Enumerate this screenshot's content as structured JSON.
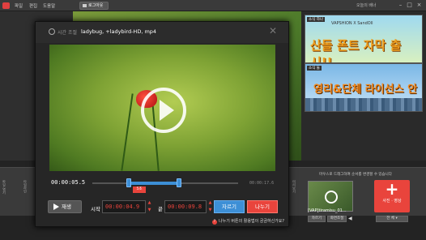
{
  "menubar": {
    "items": [
      "파일",
      "편집",
      "도움말"
    ],
    "login_label": "로그아웃",
    "right_text": "오늘의 배너",
    "window_buttons": [
      "–",
      "□",
      "×"
    ]
  },
  "ads": [
    {
      "tag": "소식 하나",
      "subtitle": "VAPSHION X SandOll",
      "headline": "산돌 폰트 자막 출시!!"
    },
    {
      "tag": "소식 둘",
      "headline": "영리&단체 라이선스 안내"
    }
  ],
  "dialog": {
    "title": "시간 조절",
    "filename": "ladybug, +ladybird-HD, mp4",
    "current_time": "00:00:05.5",
    "end_time": "00:00:17.6",
    "marker_label": "5초",
    "play_label": "재생",
    "start_label": "시작",
    "start_value": "00:00:04.9",
    "end_label": "끝",
    "end_value": "00:00:09.8",
    "cut_label": "자르기",
    "split_label": "나누기",
    "hint": "나누기 버튼의 활용법이 궁금하신가요?"
  },
  "timeline": {
    "side_labels": [
      "파일 열기",
      "타임라인",
      "미리보기"
    ],
    "hint_right": "마우스로 드래그하여 순서를 변경할 수 있습니다",
    "thumb_label": "[VAP]tiramisu_01...",
    "thumb_buttons": [
      "자르기",
      "화면조절"
    ],
    "add_media_label": "사진 · 영상",
    "select_all_label": "전 체 ▾"
  },
  "colors": {
    "accent_red": "#e9443c",
    "accent_blue": "#3d8fd6"
  },
  "icons": [
    "logo-icon",
    "clock-icon",
    "close-icon",
    "play-icon",
    "big-play-icon",
    "plus-icon",
    "speaker-icon"
  ]
}
